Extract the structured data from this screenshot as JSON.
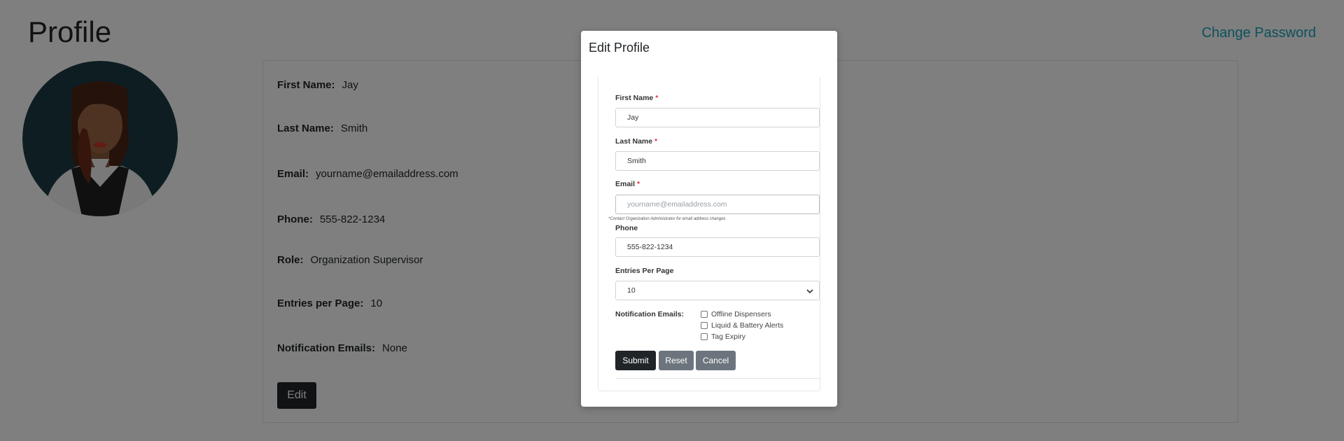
{
  "page": {
    "title": "Profile",
    "change_password_link": "Change Password",
    "avatar_icon": "user-avatar-icon"
  },
  "profile": {
    "fields": [
      {
        "label": "First Name:",
        "value": "Jay"
      },
      {
        "label": "Last Name:",
        "value": "Smith"
      },
      {
        "label": "Email:",
        "value": "yourname@emailaddress.com"
      },
      {
        "label": "Phone:",
        "value": "555-822-1234"
      },
      {
        "label": "Role:",
        "value": "Organization Supervisor"
      },
      {
        "label": "Entries per Page:",
        "value": "10"
      },
      {
        "label": "Notification Emails:",
        "value": "None"
      }
    ],
    "edit_label": "Edit"
  },
  "modal": {
    "title": "Edit Profile",
    "first_name": {
      "label": "First Name",
      "required": "*",
      "value": "Jay"
    },
    "last_name": {
      "label": "Last Name",
      "required": "*",
      "value": "Smith"
    },
    "email": {
      "label": "Email",
      "required": "*",
      "placeholder": "yourname@emailaddress.com",
      "hint": "*Contact Organization Administrator for email address changes"
    },
    "phone": {
      "label": "Phone",
      "value": "555-822-1234"
    },
    "entries_per_page": {
      "label": "Entries Per Page",
      "selected": "10"
    },
    "notification_emails": {
      "label": "Notification Emails:",
      "options": [
        {
          "label": "Offline Dispensers",
          "checked": false
        },
        {
          "label": "Liquid & Battery Alerts",
          "checked": false
        },
        {
          "label": "Tag Expiry",
          "checked": false
        }
      ]
    },
    "buttons": {
      "submit": "Submit",
      "reset": "Reset",
      "cancel": "Cancel"
    }
  },
  "colors": {
    "link": "#17a2b8",
    "dark_button": "#212529",
    "secondary_button": "#6c757d",
    "required": "#dc3545",
    "avatar_bg": "#1d3a44",
    "backdrop": "rgba(0,0,0,0.5)"
  }
}
